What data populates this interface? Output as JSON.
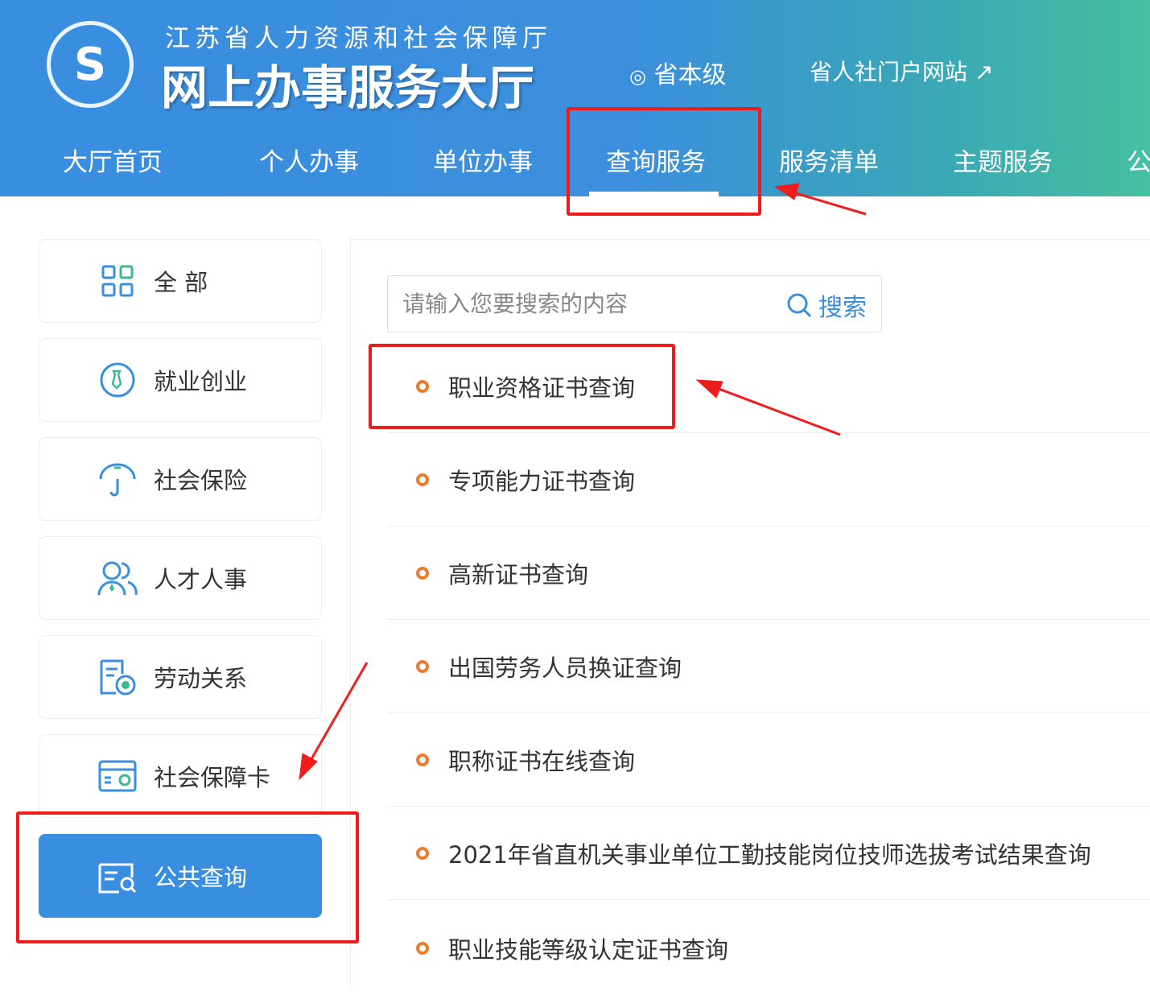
{
  "header": {
    "logo_text": "S",
    "org": "江苏省人力资源和社会保障厅",
    "hall": "网上办事服务大厅",
    "location": "省本级",
    "portal": "省人社门户网站"
  },
  "nav": [
    "大厅首页",
    "个人办事",
    "单位办事",
    "查询服务",
    "服务清单",
    "主题服务",
    "公"
  ],
  "sidebar": [
    {
      "label": "全 部",
      "icon": "grid-icon"
    },
    {
      "label": "就业创业",
      "icon": "tie-icon"
    },
    {
      "label": "社会保险",
      "icon": "umbrella-icon"
    },
    {
      "label": "人才人事",
      "icon": "users-icon"
    },
    {
      "label": "劳动关系",
      "icon": "document-star-icon"
    },
    {
      "label": "社会保障卡",
      "icon": "card-icon"
    },
    {
      "label": "公共查询",
      "icon": "search-list-icon"
    }
  ],
  "search": {
    "placeholder": "请输入您要搜索的内容",
    "button": "搜索"
  },
  "items": [
    "职业资格证书查询",
    "专项能力证书查询",
    "高新证书查询",
    "出国劳务人员换证查询",
    "职称证书在线查询",
    "2021年省直机关事业单位工勤技能岗位技师选拔考试结果查询",
    "职业技能等级认定证书查询"
  ],
  "colors": {
    "primary": "#3a8ee0",
    "accent": "#f07a2a",
    "annotation": "#f01c1c"
  }
}
